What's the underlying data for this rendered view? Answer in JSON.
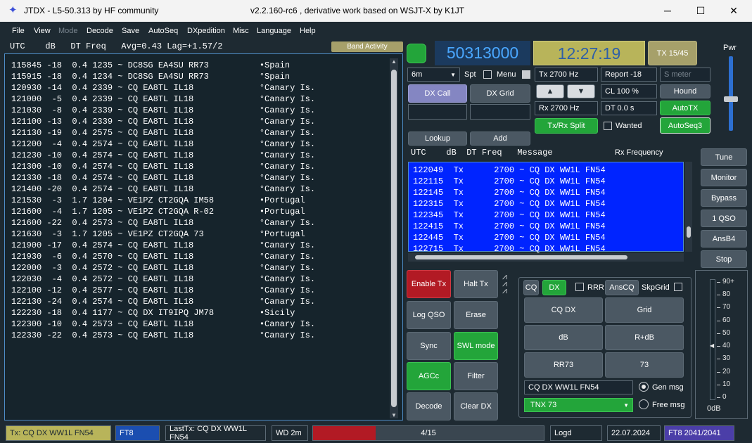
{
  "window": {
    "title": "JTDX - L5-50.313  by HF community",
    "subtitle": "v2.2.160-rc6 , derivative work based on WSJT-X by K1JT",
    "minimize": "─",
    "maximize": "☐",
    "close": "✕"
  },
  "menu": {
    "items": [
      "File",
      "View",
      "Mode",
      "Decode",
      "Save",
      "AutoSeq",
      "DXpedition",
      "Misc",
      "Language",
      "Help"
    ]
  },
  "band_activity": {
    "header": "UTC    dB   DT Freq   Avg=0.43 Lag=+1.57/2",
    "button_label": "Band Activity",
    "rows": [
      "115845 -18  0.4 1235 ~ DC8SG EA4SU RR73          •Spain",
      "115915 -18  0.4 1234 ~ DC8SG EA4SU RR73          °Spain",
      "120930 -14  0.4 2339 ~ CQ EA8TL IL18             °Canary Is.",
      "121000  -5  0.4 2339 ~ CQ EA8TL IL18             °Canary Is.",
      "121030  -8  0.4 2339 ~ CQ EA8TL IL18             °Canary Is.",
      "121100 -13  0.4 2339 ~ CQ EA8TL IL18             °Canary Is.",
      "121130 -19  0.4 2575 ~ CQ EA8TL IL18             °Canary Is.",
      "121200  -4  0.4 2574 ~ CQ EA8TL IL18             °Canary Is.",
      "121230 -10  0.4 2574 ~ CQ EA8TL IL18             °Canary Is.",
      "121300 -10  0.4 2574 ~ CQ EA8TL IL18             °Canary Is.",
      "121330 -18  0.4 2574 ~ CQ EA8TL IL18             °Canary Is.",
      "121400 -20  0.4 2574 ~ CQ EA8TL IL18             °Canary Is.",
      "121530  -3  1.7 1204 ~ VE1PZ CT2GQA IM58         •Portugal",
      "121600  -4  1.7 1205 ~ VE1PZ CT2GQA R-02         •Portugal",
      "121600 -22  0.4 2573 ~ CQ EA8TL IL18             °Canary Is.",
      "121630  -3  1.7 1205 ~ VE1PZ CT2GQA 73           °Portugal",
      "121900 -17  0.4 2574 ~ CQ EA8TL IL18             °Canary Is.",
      "121930  -6  0.4 2570 ~ CQ EA8TL IL18             °Canary Is.",
      "122000  -3  0.4 2572 ~ CQ EA8TL IL18             °Canary Is.",
      "122030  -4  0.4 2572 ~ CQ EA8TL IL18             °Canary Is.",
      "122100 -12  0.4 2577 ~ CQ EA8TL IL18             °Canary Is.",
      "122130 -24  0.4 2574 ~ CQ EA8TL IL18             °Canary Is.",
      "122230 -18  0.4 1177 ~ CQ DX IT9IPQ JM78         •Sicily",
      "122300 -10  0.4 2573 ~ CQ EA8TL IL18             •Canary Is.",
      "122330 -22  0.4 2573 ~ CQ EA8TL IL18             °Canary Is."
    ]
  },
  "controls": {
    "dial_frequency": "50313000",
    "clock": "12:27:19",
    "tx_counter": "TX 15/45",
    "band": "6m",
    "spt_label": "Spt",
    "menu_label": "Menu",
    "tx_freq": "Tx  2700  Hz",
    "rx_freq": "Rx  2700  Hz",
    "report": "Report -18",
    "smeter_placeholder": "S meter",
    "cl": "CL  100 %",
    "dt": "DT 0.0 s",
    "dx_call": "DX Call",
    "dx_grid": "DX Grid",
    "lookup": "Lookup",
    "add": "Add",
    "hound": "Hound",
    "autotx": "AutoTX",
    "txrx_split": "Tx/Rx Split",
    "wanted": "Wanted",
    "autoseq3": "AutoSeq3",
    "up": "▲",
    "down": "▼"
  },
  "pwr": {
    "label": "Pwr",
    "level": 0.42
  },
  "tx_messages": {
    "header": "UTC    dB  DT Freq   Message",
    "rx_freq_label": "Rx Frequency",
    "rows": [
      "122049  Tx      2700 ~ CQ DX WW1L FN54",
      "122115  Tx      2700 ~ CQ DX WW1L FN54",
      "122145  Tx      2700 ~ CQ DX WW1L FN54",
      "122315  Tx      2700 ~ CQ DX WW1L FN54",
      "122345  Tx      2700 ~ CQ DX WW1L FN54",
      "122415  Tx      2700 ~ CQ DX WW1L FN54",
      "122445  Tx      2700 ~ CQ DX WW1L FN54",
      "122715  Tx      2700 ~ CQ DX WW1L FN54"
    ]
  },
  "side_buttons": [
    "Tune",
    "Monitor",
    "Bypass",
    "1 QSO",
    "AnsB4",
    "Stop"
  ],
  "left_buttons": {
    "enable_tx": "Enable Tx",
    "halt_tx": "Halt Tx",
    "log_qso": "Log QSO",
    "erase": "Erase",
    "sync": "Sync",
    "swl_mode": "SWL mode",
    "agcc": "AGCc",
    "filter": "Filter",
    "decode": "Decode",
    "clear_dx": "Clear DX"
  },
  "msg_panel": {
    "cq": "CQ",
    "dx": "DX",
    "rrr": "RRR",
    "anscq": "AnsCQ",
    "skpgrid": "SkpGrid",
    "cq_dx": "CQ DX",
    "grid": "Grid",
    "db": "dB",
    "r_db": "R+dB",
    "rr73": "RR73",
    "m73": "73",
    "gen_text": "CQ DX WW1L FN54",
    "free_text": "TNX 73",
    "gen_msg": "Gen msg",
    "free_msg": "Free msg"
  },
  "meter": {
    "ticks": [
      "90+",
      "80",
      "70",
      "60",
      "50",
      "40",
      "30",
      "20",
      "10",
      "0"
    ],
    "caption": "0dB",
    "value_db": 40
  },
  "status": {
    "tx": "Tx: CQ DX WW1L FN54",
    "mode": "FT8",
    "lasttx": "LastTx: CQ DX WW1L FN54",
    "wd": "WD 2m",
    "progress": "4/15",
    "progress_fraction": 0.27,
    "logd": "Logd",
    "date": "22.07.2024",
    "counter": "FT8  2041/2041"
  },
  "colors": {
    "green": "#23a53a",
    "red": "#b21a24",
    "purple": "#8486c2",
    "olive": "#a6a06a",
    "tx_list": "#0024ff"
  }
}
